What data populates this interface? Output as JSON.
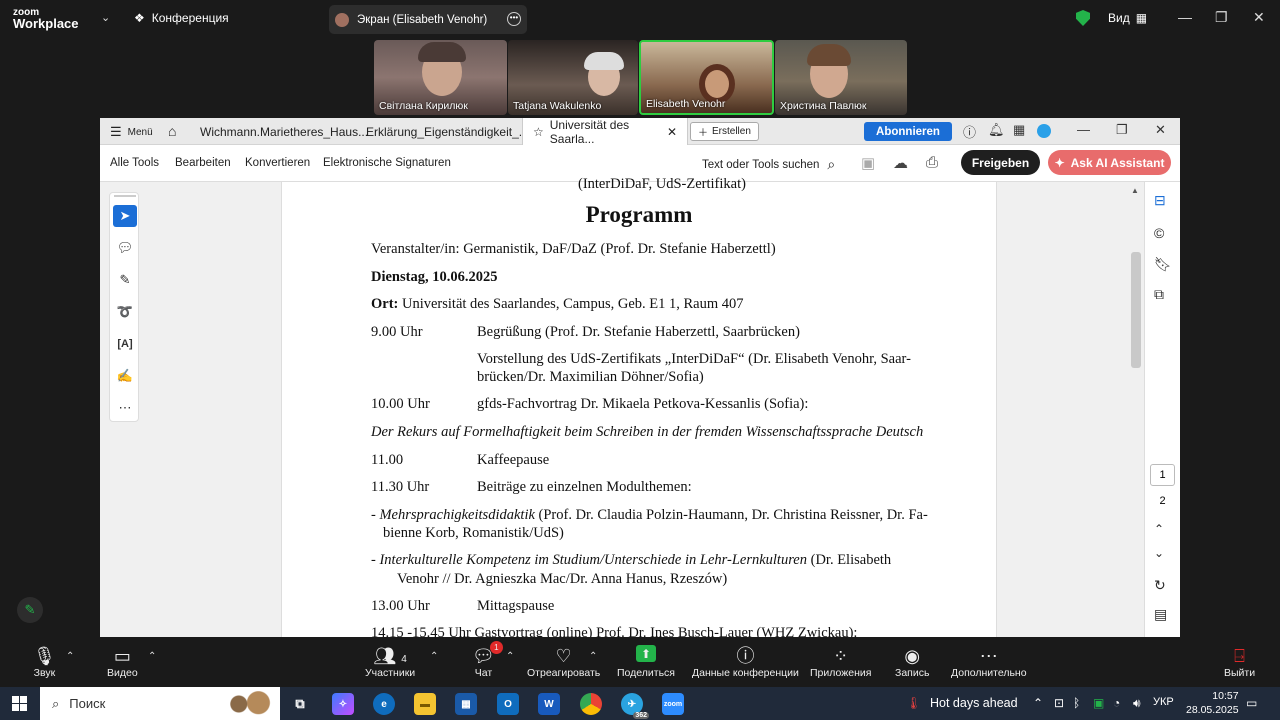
{
  "zoom": {
    "logo_top": "zoom",
    "logo_bottom": "Workplace",
    "conference_label": "Конференция",
    "screen_share_label": "Экран (Elisabeth Venohr)",
    "view_label": "Вид",
    "participants": [
      {
        "name": "Світлана Кирилюк"
      },
      {
        "name": "Tatjana Wakulenko"
      },
      {
        "name": "Elisabeth Venohr"
      },
      {
        "name": "Христина Павлюк"
      }
    ],
    "controls": {
      "audio": "Звук",
      "video": "Видео",
      "participants": "Участники",
      "participants_count": "4",
      "chat": "Чат",
      "chat_badge": "1",
      "react": "Отреагировать",
      "share": "Поделиться",
      "meeting_info": "Данные конференции",
      "apps": "Приложения",
      "record": "Запись",
      "more": "Дополнительно",
      "leave": "Выйти"
    }
  },
  "acrobat": {
    "menu_label": "Menü",
    "tabs": [
      {
        "label": "Wichmann.Marietheres_Haus..."
      },
      {
        "label": "Erklärung_Eigenständigkeit_..."
      },
      {
        "label": "Universität des Saarla..."
      }
    ],
    "new_tab_label": "Erstellen",
    "subscribe_label": "Abonnieren",
    "toolbar": {
      "all_tools": "Alle Tools",
      "edit": "Bearbeiten",
      "convert": "Konvertieren",
      "esign": "Elektronische Signaturen",
      "search_placeholder": "Text oder Tools suchen",
      "share": "Freigeben",
      "ai": "Ask AI Assistant"
    },
    "page_numbers": [
      "1",
      "2"
    ]
  },
  "document": {
    "top_cut": "(InterDiDaF, UdS-Zertifikat)",
    "title": "Programm",
    "organizer": "Veranstalter/in: Germanistik, DaF/DaZ (Prof. Dr. Stefanie Haberzettl)",
    "date": "Dienstag, 10.06.2025",
    "place_label": "Ort:",
    "place": " Universität des Saarlandes, Campus, Geb. E1 1, Raum 407",
    "rows": [
      {
        "time": "9.00 Uhr",
        "text": "Begrüßung (Prof. Dr. Stefanie Haberzettl, Saarbrücken)"
      },
      {
        "time": "",
        "text": "Vorstellung des UdS-Zertifikats „InterDiDaF“ (Dr. Elisabeth Venohr, Saar-",
        "text2": "brücken/Dr. Maximilian Döhner/Sofia)"
      },
      {
        "time": "10.00 Uhr",
        "text": "gfds-Fachvortrag Dr. Mikaela Petkova-Kessanlis (Sofia):"
      }
    ],
    "lecture_title": "Der Rekurs auf Formelhaftigkeit beim Schreiben in der fremden Wissenschaftssprache Deutsch",
    "rows2": [
      {
        "time": "11.00",
        "text": "Kaffeepause"
      },
      {
        "time": "11.30 Uhr",
        "text": "Beiträge zu einzelnen Modulthemen:"
      }
    ],
    "module1_prefix": "- ",
    "module1_italic": "Mehrsprachigkeitsdidaktik",
    "module1_rest": " (Prof. Dr. Claudia Polzin-Haumann, Dr. Christina Reissner, Dr. Fa-",
    "module1_line2": "bienne Korb, Romanistik/UdS)",
    "module2_prefix": "- ",
    "module2_italic": "Interkulturelle Kompetenz im Studium/Unterschiede in Lehr-Lernkulturen",
    "module2_rest": " (Dr. Elisabeth",
    "module2_line2": "Venohr // Dr. Agnieszka Mac/Dr. Anna Hanus, Rzeszów)",
    "lunch_time": "13.00 Uhr",
    "lunch": "Mittagspause",
    "bottom_cut": "14.15 -15.45 Uhr  Gastvortrag (online) Prof. Dr. Ines Busch-Lauer (WHZ Zwickau):"
  },
  "taskbar": {
    "search_label": "Поиск",
    "weather": "Hot days ahead",
    "language": "УКР",
    "time": "10:57",
    "date": "28.05.2025",
    "telegram_badge": "362"
  }
}
